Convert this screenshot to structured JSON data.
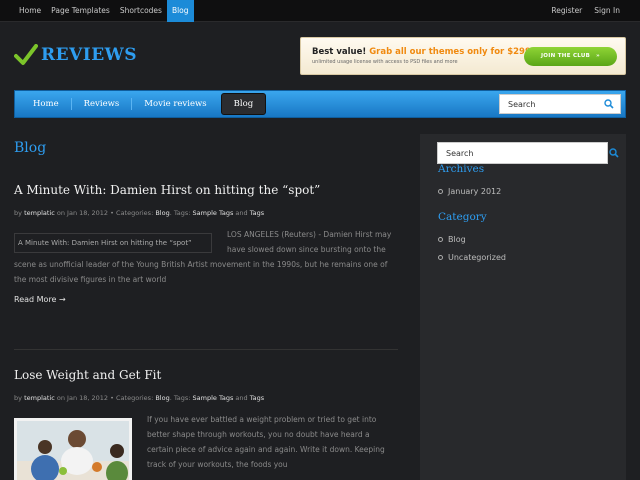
{
  "topbar": {
    "nav": [
      "Home",
      "Page Templates",
      "Shortcodes",
      "Blog"
    ],
    "active_nav": "Blog",
    "right": [
      "Register",
      "Sign In"
    ]
  },
  "logo": {
    "name": "REVIEWS",
    "accent": "#2e9df0",
    "check_color": "#7cc42a"
  },
  "promo": {
    "headline_prefix": "Best value!",
    "headline_highlight": "Grab all our themes only for $299",
    "subline": "unlimited usage license with access to PSD files and more",
    "button_label": "JOIN THE CLUB",
    "button_arrow": "»"
  },
  "mainnav": {
    "items": [
      "Home",
      "Reviews",
      "Movie reviews",
      "Blog"
    ],
    "active": "Blog",
    "search_placeholder": "Search"
  },
  "page_title": "Blog",
  "posts": [
    {
      "title": "A Minute With: Damien Hirst on hitting the “spot”",
      "meta": {
        "by": "by",
        "author": "templatic",
        "on": "on Jan 18, 2012 • Categories:",
        "category": "Blog",
        "tags_label": ". Tags:",
        "tag1": "Sample Tags",
        "and": "and",
        "tag2": "Tags"
      },
      "image_alt": "A Minute With: Damien Hirst on hitting the “spot”",
      "excerpt": "LOS ANGELES (Reuters) - Damien Hirst may have slowed down since bursting onto the scene as unofficial leader of the Young British Artist movement in the 1990s, but he remains one of the most divisive figures in the art world",
      "read_more": "Read More →"
    },
    {
      "title": "Lose Weight and Get Fit",
      "meta": {
        "by": "by",
        "author": "templatic",
        "on": "on Jan 18, 2012 • Categories:",
        "category": "Blog",
        "tags_label": ". Tags:",
        "tag1": "Sample Tags",
        "and": "and",
        "tag2": "Tags"
      },
      "excerpt": "If you have ever battled a weight problem or tried to get into better shape through workouts, you no doubt have heard a certain piece of advice again and again. Write it down. Keeping track of your workouts, the foods you"
    }
  ],
  "sidebar": {
    "search_placeholder": "Search",
    "archives_title": "Archives",
    "archives": [
      "January 2012"
    ],
    "category_title": "Category",
    "categories": [
      "Blog",
      "Uncategorized"
    ]
  }
}
